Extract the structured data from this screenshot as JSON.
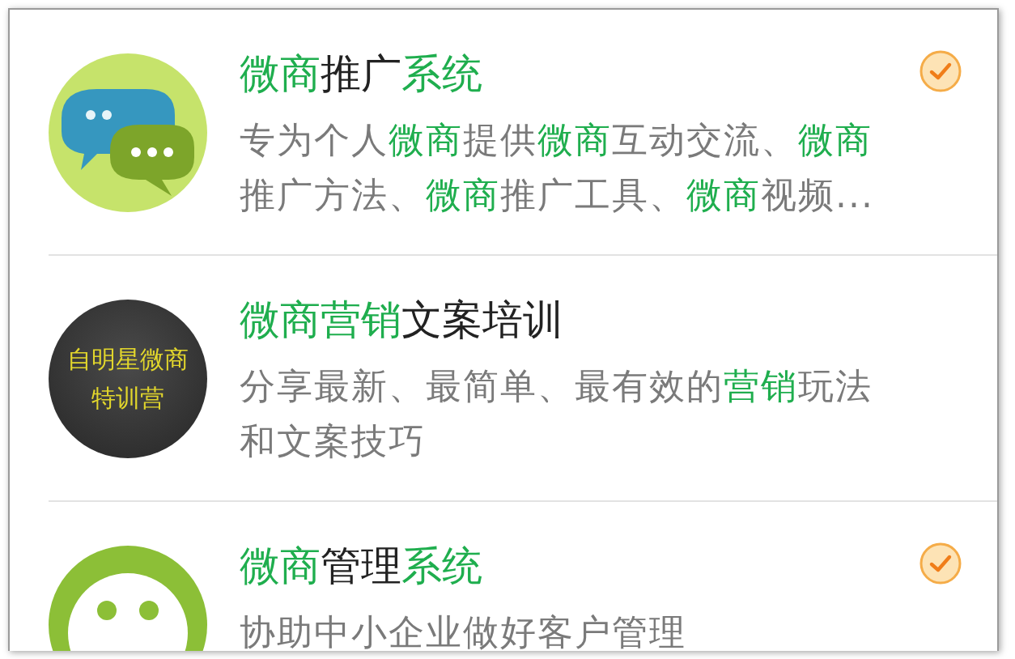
{
  "items": [
    {
      "avatar": {
        "kind": "chat-bubbles"
      },
      "title": [
        {
          "text": "微商",
          "highlight": true
        },
        {
          "text": "推广",
          "highlight": false
        },
        {
          "text": "系统",
          "highlight": true
        }
      ],
      "description": [
        [
          {
            "text": "专为个人",
            "highlight": false
          },
          {
            "text": "微商",
            "highlight": true
          },
          {
            "text": "提供",
            "highlight": false
          },
          {
            "text": "微商",
            "highlight": true
          },
          {
            "text": "互动交流、",
            "highlight": false
          },
          {
            "text": "微商",
            "highlight": true
          }
        ],
        [
          {
            "text": "推广方法、",
            "highlight": false
          },
          {
            "text": "微商",
            "highlight": true
          },
          {
            "text": "推广工具、",
            "highlight": false
          },
          {
            "text": "微商",
            "highlight": true
          },
          {
            "text": "视频...",
            "highlight": false
          }
        ]
      ],
      "checked": true
    },
    {
      "avatar": {
        "kind": "text-badge",
        "lines": [
          "自明星微商",
          "特训营"
        ]
      },
      "title": [
        {
          "text": "微商营销",
          "highlight": true
        },
        {
          "text": "文案培训",
          "highlight": false
        }
      ],
      "description": [
        [
          {
            "text": "分享最新、最简单、最有效的",
            "highlight": false
          },
          {
            "text": "营销",
            "highlight": true
          },
          {
            "text": "玩法",
            "highlight": false
          }
        ],
        [
          {
            "text": "和文案技巧",
            "highlight": false
          }
        ]
      ],
      "checked": false
    },
    {
      "avatar": {
        "kind": "smiley"
      },
      "title": [
        {
          "text": "微商",
          "highlight": true
        },
        {
          "text": "管理",
          "highlight": false
        },
        {
          "text": "系统",
          "highlight": true
        }
      ],
      "description": [
        [
          {
            "text": "协助中小企业做好客户管理",
            "highlight": false
          }
        ]
      ],
      "checked": true
    }
  ]
}
